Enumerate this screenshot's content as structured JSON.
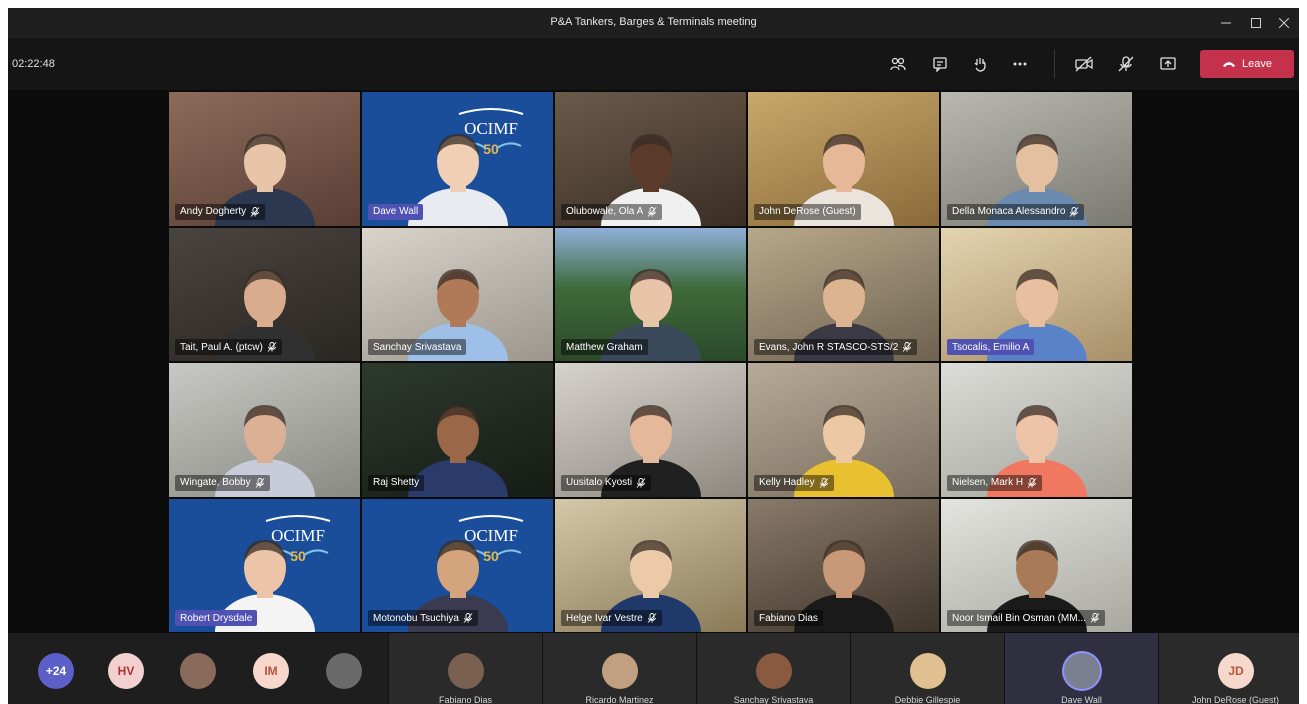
{
  "window": {
    "title": "P&A Tankers, Barges & Terminals meeting"
  },
  "toolbar": {
    "timer": "02:22:48",
    "leave_label": "Leave"
  },
  "colors": {
    "leave": "#c4314b",
    "accent": "#4f52b2"
  },
  "tiles": [
    {
      "name": "Andy Dogherty",
      "muted": true
    },
    {
      "name": "Dave Wall",
      "muted": false,
      "highlight": true
    },
    {
      "name": "Olubowale, Ola A",
      "muted": true
    },
    {
      "name": "John DeRose (Guest)",
      "muted": false
    },
    {
      "name": "Della Monaca Alessandro",
      "muted": true
    },
    {
      "name": "Tait, Paul A. (ptcw)",
      "muted": true
    },
    {
      "name": "Sanchay Srivastava",
      "muted": false
    },
    {
      "name": "Matthew Graham",
      "muted": false
    },
    {
      "name": "Evans, John R STASCO-STS/2",
      "muted": true
    },
    {
      "name": "Tsocalis, Emilio A",
      "muted": false,
      "highlight": true
    },
    {
      "name": "Wingate, Bobby",
      "muted": true
    },
    {
      "name": "Raj Shetty",
      "muted": false
    },
    {
      "name": "Uusitalo Kyosti",
      "muted": true
    },
    {
      "name": "Kelly Hadley",
      "muted": true
    },
    {
      "name": "Nielsen, Mark H",
      "muted": true
    },
    {
      "name": "Robert Drysdale",
      "muted": false,
      "highlight": true
    },
    {
      "name": "Motonobu Tsuchiya",
      "muted": true
    },
    {
      "name": "Helge Ivar Vestre",
      "muted": true
    },
    {
      "name": "Fabiano Dias",
      "muted": false
    },
    {
      "name": "Noor Ismail Bin Osman (MM...",
      "muted": true
    }
  ],
  "ocimf_label": "OCIMF",
  "strip": {
    "overflow_count": "+24",
    "avatars": [
      "HV",
      "IM"
    ],
    "pills": [
      "Fabiano Dias",
      "Ricardo Martinez",
      "Sanchay Srivastava",
      "Debbie Gillespie",
      "Dave Wall",
      "John DeRose (Guest)"
    ],
    "last_initials": "JD"
  }
}
